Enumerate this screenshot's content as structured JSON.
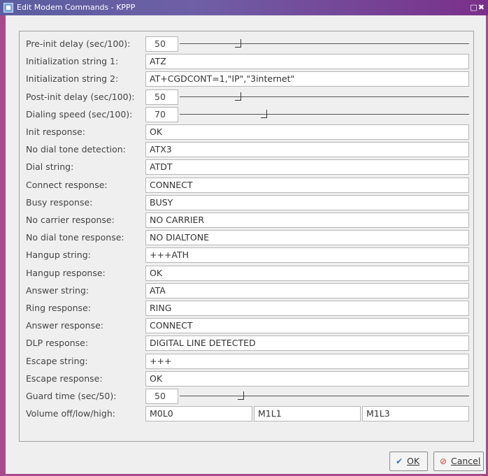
{
  "window": {
    "title": "Edit Modem Commands - KPPP",
    "controls": "□✖"
  },
  "rows": [
    {
      "label": "Pre-init delay (sec/100):",
      "value": "50",
      "kind": "slider",
      "level": 0.19
    },
    {
      "label": "Initialization string 1:",
      "value": "ATZ",
      "kind": "text"
    },
    {
      "label": "Initialization string 2:",
      "value": "AT+CGDCONT=1,\"IP\",\"3internet\"",
      "kind": "text"
    },
    {
      "label": "Post-init delay (sec/100):",
      "value": "50",
      "kind": "slider",
      "level": 0.19
    },
    {
      "label": "Dialing speed (sec/100):",
      "value": "70",
      "kind": "slider",
      "level": 0.28
    },
    {
      "label": "Init response:",
      "value": "OK",
      "kind": "text"
    },
    {
      "label": "No dial tone detection:",
      "value": "ATX3",
      "kind": "text"
    },
    {
      "label": "Dial string:",
      "value": "ATDT",
      "kind": "text"
    },
    {
      "label": "Connect response:",
      "value": "CONNECT",
      "kind": "text"
    },
    {
      "label": "Busy response:",
      "value": "BUSY",
      "kind": "text"
    },
    {
      "label": "No carrier response:",
      "value": "NO CARRIER",
      "kind": "text"
    },
    {
      "label": "No dial tone response:",
      "value": "NO DIALTONE",
      "kind": "text"
    },
    {
      "label": "Hangup string:",
      "value": "+++ATH",
      "kind": "text"
    },
    {
      "label": "Hangup response:",
      "value": "OK",
      "kind": "text"
    },
    {
      "label": "Answer string:",
      "value": "ATA",
      "kind": "text"
    },
    {
      "label": "Ring response:",
      "value": "RING",
      "kind": "text"
    },
    {
      "label": "Answer response:",
      "value": "CONNECT",
      "kind": "text"
    },
    {
      "label": "DLP response:",
      "value": "DIGITAL LINE DETECTED",
      "kind": "text"
    },
    {
      "label": "Escape string:",
      "value": "+++",
      "kind": "text"
    },
    {
      "label": "Escape response:",
      "value": "OK",
      "kind": "text"
    },
    {
      "label": "Guard time (sec/50):",
      "value": "50",
      "kind": "slider",
      "level": 0.2
    }
  ],
  "volume": {
    "label": "Volume off/low/high:",
    "off": "M0L0",
    "low": "M1L1",
    "high": "M1L3"
  },
  "buttons": {
    "ok": {
      "label": "OK",
      "icon": "check-icon"
    },
    "cancel": {
      "label": "Cancel",
      "icon": "cancel-icon"
    }
  },
  "colors": {
    "titlebar": "#6e5fa6",
    "frame": "#a84a8a",
    "check": "#3a6fb0",
    "cancel": "#d43a2a"
  }
}
